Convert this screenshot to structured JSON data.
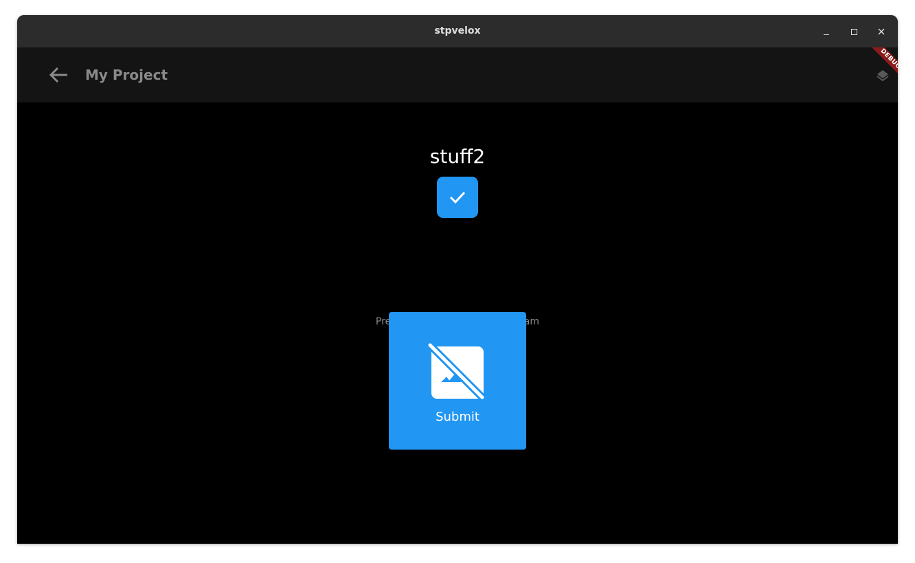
{
  "window": {
    "title": "stpvelox",
    "controls": {
      "minimize": "minimize-icon",
      "maximize": "maximize-icon",
      "close": "close-icon"
    }
  },
  "appbar": {
    "title": "My Project",
    "back_icon": "arrow-back-icon",
    "action_icon": "layers-icon"
  },
  "debug_banner": "DEBUG",
  "main": {
    "item_title": "stuff2",
    "checkbox_checked": true,
    "hint_text": "Press Submit to start the program",
    "submit": {
      "label": "Submit",
      "icon": "hide-image-icon"
    }
  },
  "colors": {
    "accent": "#2196f3",
    "background": "#000000",
    "appbar": "#141414",
    "titlebar": "#2c2c2c",
    "debug": "#8b1a1a"
  }
}
